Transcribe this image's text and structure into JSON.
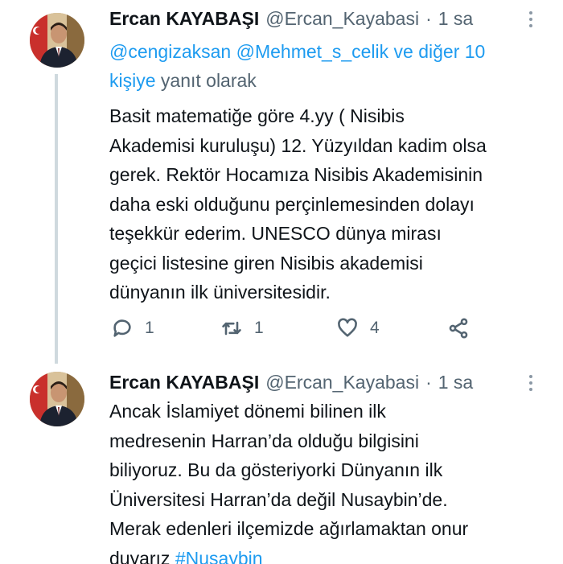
{
  "tweets": [
    {
      "author_name": "Ercan KAYABAŞI",
      "author_handle": "@Ercan_Kayabasi",
      "separator": "·",
      "time": "1 sa",
      "reply_to": {
        "mention_1": "@cengizaksan",
        "mention_2": "@Mehmet_s_celik",
        "others_line1": "ve diğer 10",
        "others_line2": "kişiye",
        "suffix": "yanıt olarak"
      },
      "body_lines": [
        "Basit matematiğe göre 4.yy ( Nisibis",
        "Akademisi kuruluşu) 12. Yüzyıldan kadim olsa",
        "gerek. Rektör Hocamıza Nisibis Akademisinin",
        "daha eski olduğunu perçinlemesinden dolayı",
        "teşekkür ederim. UNESCO dünya mirası",
        "geçici listesine giren Nisibis akademisi",
        "dünyanın ilk üniversitesidir."
      ],
      "actions": {
        "reply_count": "1",
        "retweet_count": "1",
        "like_count": "4"
      },
      "icons": [
        "avatar",
        "more-icon",
        "reply-icon",
        "retweet-icon",
        "like-icon",
        "share-icon"
      ]
    },
    {
      "author_name": "Ercan KAYABAŞI",
      "author_handle": "@Ercan_Kayabasi",
      "separator": "·",
      "time": "1 sa",
      "body_lines": [
        "Ancak İslamiyet dönemi bilinen ilk",
        "medresenin Harran’da olduğu bilgisini",
        "biliyoruz. Bu da gösteriyorki Dünyanın ilk",
        "Üniversitesi Harran’da değil Nusaybin’de.",
        "Merak edenleri ilçemizde ağırlamaktan onur"
      ],
      "last_line_text": "duyarız",
      "hashtag": "#Nusaybin"
    }
  ],
  "colors": {
    "text": "#0f1419",
    "secondary": "#536471",
    "link": "#1d9bf0",
    "thread_line": "#cfd9de"
  }
}
